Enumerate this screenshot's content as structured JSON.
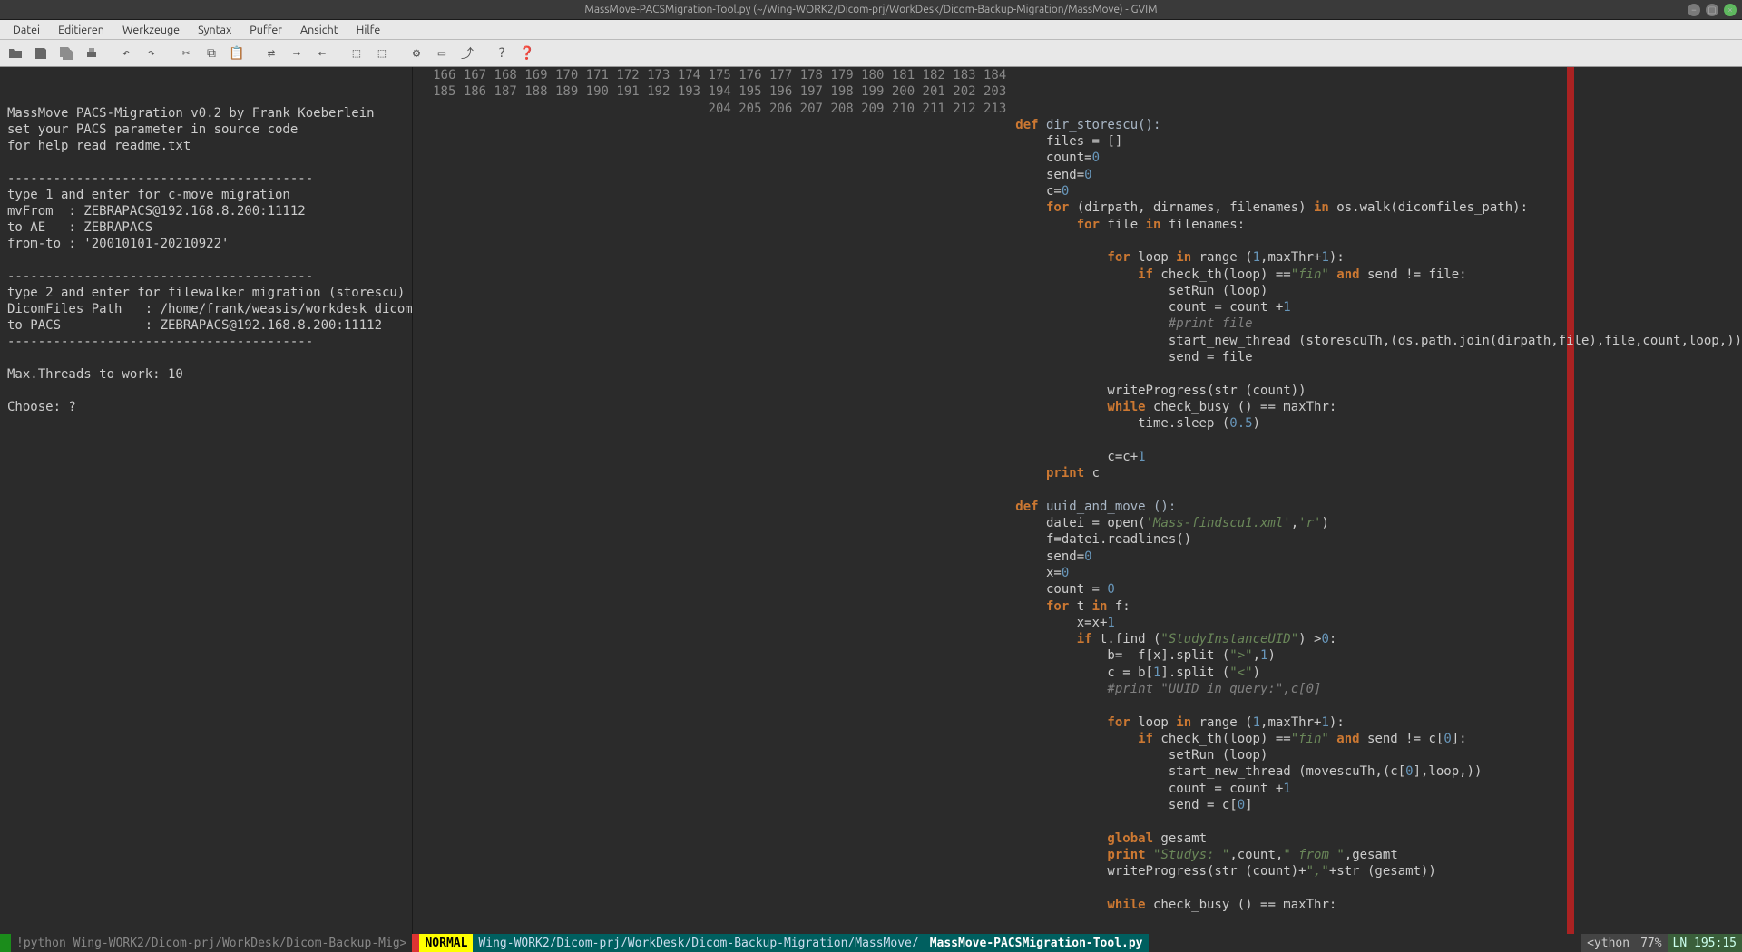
{
  "window": {
    "title": "MassMove-PACSMigration-Tool.py (~/Wing-WORK2/Dicom-prj/WorkDesk/Dicom-Backup-Migration/MassMove) - GVIM"
  },
  "menu": {
    "items": [
      "Datei",
      "Editieren",
      "Werkzeuge",
      "Syntax",
      "Puffer",
      "Ansicht",
      "Hilfe"
    ]
  },
  "left_pane": {
    "lines": [
      "",
      "",
      "MassMove PACS-Migration v0.2 by Frank Koeberlein",
      "set your PACS parameter in source code",
      "for help read readme.txt",
      "",
      "----------------------------------------",
      "type 1 and enter for c-move migration",
      "mvFrom  : ZEBRAPACS@192.168.8.200:11112",
      "to AE   : ZEBRAPACS",
      "from-to : '20010101-20210922'",
      "",
      "----------------------------------------",
      "type 2 and enter for filewalker migration (storescu)",
      "DicomFiles Path   : /home/frank/weasis/workdesk_dicom/",
      "to PACS           : ZEBRAPACS@192.168.8.200:11112",
      "----------------------------------------",
      "",
      "Max.Threads to work: 10",
      "",
      "Choose: ?"
    ]
  },
  "code": {
    "first_line": 166,
    "lines": [
      {
        "n": 166,
        "tokens": [
          {
            "t": "def ",
            "c": "kw"
          },
          {
            "t": "dir_storescu():",
            "c": "def"
          }
        ]
      },
      {
        "n": 167,
        "tokens": [
          {
            "t": "    files = []",
            "c": ""
          }
        ]
      },
      {
        "n": 168,
        "tokens": [
          {
            "t": "    count=",
            "c": ""
          },
          {
            "t": "0",
            "c": "num"
          }
        ]
      },
      {
        "n": 169,
        "tokens": [
          {
            "t": "    send=",
            "c": ""
          },
          {
            "t": "0",
            "c": "num"
          }
        ]
      },
      {
        "n": 170,
        "tokens": [
          {
            "t": "    c=",
            "c": ""
          },
          {
            "t": "0",
            "c": "num"
          }
        ]
      },
      {
        "n": 171,
        "tokens": [
          {
            "t": "    ",
            "c": ""
          },
          {
            "t": "for",
            "c": "kw"
          },
          {
            "t": " (dirpath, dirnames, filenames) ",
            "c": ""
          },
          {
            "t": "in",
            "c": "kw"
          },
          {
            "t": " os.walk(dicomfiles_path):",
            "c": ""
          }
        ]
      },
      {
        "n": 172,
        "tokens": [
          {
            "t": "        ",
            "c": ""
          },
          {
            "t": "for",
            "c": "kw"
          },
          {
            "t": " file ",
            "c": ""
          },
          {
            "t": "in",
            "c": "kw"
          },
          {
            "t": " filenames:",
            "c": ""
          }
        ]
      },
      {
        "n": 173,
        "tokens": [
          {
            "t": "",
            "c": ""
          }
        ]
      },
      {
        "n": 174,
        "tokens": [
          {
            "t": "            ",
            "c": ""
          },
          {
            "t": "for",
            "c": "kw"
          },
          {
            "t": " loop ",
            "c": ""
          },
          {
            "t": "in",
            "c": "kw"
          },
          {
            "t": " range (",
            "c": ""
          },
          {
            "t": "1",
            "c": "num"
          },
          {
            "t": ",maxThr+",
            "c": ""
          },
          {
            "t": "1",
            "c": "num"
          },
          {
            "t": "):",
            "c": ""
          }
        ]
      },
      {
        "n": 175,
        "tokens": [
          {
            "t": "                ",
            "c": ""
          },
          {
            "t": "if",
            "c": "kw"
          },
          {
            "t": " check_th(loop) ==",
            "c": ""
          },
          {
            "t": "\"fin\"",
            "c": "str"
          },
          {
            "t": " ",
            "c": ""
          },
          {
            "t": "and",
            "c": "kw"
          },
          {
            "t": " send != file:",
            "c": ""
          }
        ]
      },
      {
        "n": 176,
        "tokens": [
          {
            "t": "                    setRun (loop)",
            "c": ""
          }
        ]
      },
      {
        "n": 177,
        "tokens": [
          {
            "t": "                    count = count +",
            "c": ""
          },
          {
            "t": "1",
            "c": "num"
          }
        ]
      },
      {
        "n": 178,
        "tokens": [
          {
            "t": "                    ",
            "c": ""
          },
          {
            "t": "#print file",
            "c": "cmt"
          }
        ]
      },
      {
        "n": 179,
        "tokens": [
          {
            "t": "                    start_new_thread (storescuTh,(os.path.join(dirpath,file),file,count,loop,))",
            "c": ""
          }
        ]
      },
      {
        "n": 180,
        "tokens": [
          {
            "t": "                    send = file",
            "c": ""
          }
        ]
      },
      {
        "n": 181,
        "tokens": [
          {
            "t": "",
            "c": ""
          }
        ]
      },
      {
        "n": 182,
        "tokens": [
          {
            "t": "            writeProgress(str (count))",
            "c": ""
          }
        ]
      },
      {
        "n": 183,
        "tokens": [
          {
            "t": "            ",
            "c": ""
          },
          {
            "t": "while",
            "c": "kw"
          },
          {
            "t": " check_busy () == maxThr:",
            "c": ""
          }
        ]
      },
      {
        "n": 184,
        "tokens": [
          {
            "t": "                time.sleep (",
            "c": ""
          },
          {
            "t": "0.5",
            "c": "num"
          },
          {
            "t": ")",
            "c": ""
          }
        ]
      },
      {
        "n": 185,
        "tokens": [
          {
            "t": "",
            "c": ""
          }
        ]
      },
      {
        "n": 186,
        "tokens": [
          {
            "t": "            c=c+",
            "c": ""
          },
          {
            "t": "1",
            "c": "num"
          }
        ]
      },
      {
        "n": 187,
        "tokens": [
          {
            "t": "    ",
            "c": ""
          },
          {
            "t": "print",
            "c": "kw"
          },
          {
            "t": " c",
            "c": ""
          }
        ]
      },
      {
        "n": 188,
        "tokens": [
          {
            "t": "",
            "c": ""
          }
        ]
      },
      {
        "n": 189,
        "tokens": [
          {
            "t": "def ",
            "c": "kw"
          },
          {
            "t": "uuid_and_move ():",
            "c": "def"
          }
        ]
      },
      {
        "n": 190,
        "tokens": [
          {
            "t": "    datei = open(",
            "c": ""
          },
          {
            "t": "'Mass-findscu1.xml'",
            "c": "str"
          },
          {
            "t": ",",
            "c": ""
          },
          {
            "t": "'r'",
            "c": "str"
          },
          {
            "t": ")",
            "c": ""
          }
        ]
      },
      {
        "n": 191,
        "tokens": [
          {
            "t": "    f=datei.readlines()",
            "c": ""
          }
        ]
      },
      {
        "n": 192,
        "tokens": [
          {
            "t": "    send=",
            "c": ""
          },
          {
            "t": "0",
            "c": "num"
          }
        ]
      },
      {
        "n": 193,
        "tokens": [
          {
            "t": "    x=",
            "c": ""
          },
          {
            "t": "0",
            "c": "num"
          }
        ]
      },
      {
        "n": 194,
        "tokens": [
          {
            "t": "    count = ",
            "c": ""
          },
          {
            "t": "0",
            "c": "num"
          }
        ]
      },
      {
        "n": 195,
        "tokens": [
          {
            "t": "    ",
            "c": ""
          },
          {
            "t": "for",
            "c": "kw"
          },
          {
            "t": " t ",
            "c": ""
          },
          {
            "t": "in",
            "c": "kw"
          },
          {
            "t": " f:",
            "c": ""
          }
        ]
      },
      {
        "n": 196,
        "tokens": [
          {
            "t": "        x=x+",
            "c": ""
          },
          {
            "t": "1",
            "c": "num"
          }
        ]
      },
      {
        "n": 197,
        "tokens": [
          {
            "t": "        ",
            "c": ""
          },
          {
            "t": "if",
            "c": "kw"
          },
          {
            "t": " t.find (",
            "c": ""
          },
          {
            "t": "\"StudyInstanceUID\"",
            "c": "str"
          },
          {
            "t": ") >",
            "c": ""
          },
          {
            "t": "0",
            "c": "num"
          },
          {
            "t": ":",
            "c": ""
          }
        ]
      },
      {
        "n": 198,
        "tokens": [
          {
            "t": "            b=  f[x].split (",
            "c": ""
          },
          {
            "t": "\">\"",
            "c": "str"
          },
          {
            "t": ",",
            "c": ""
          },
          {
            "t": "1",
            "c": "num"
          },
          {
            "t": ")",
            "c": ""
          }
        ]
      },
      {
        "n": 199,
        "tokens": [
          {
            "t": "            c = b[",
            "c": ""
          },
          {
            "t": "1",
            "c": "num"
          },
          {
            "t": "].split (",
            "c": ""
          },
          {
            "t": "\"<\"",
            "c": "str"
          },
          {
            "t": ")",
            "c": ""
          }
        ]
      },
      {
        "n": 200,
        "tokens": [
          {
            "t": "            ",
            "c": ""
          },
          {
            "t": "#print \"UUID in query:\",c[0]",
            "c": "cmt"
          }
        ]
      },
      {
        "n": 201,
        "tokens": [
          {
            "t": "",
            "c": ""
          }
        ]
      },
      {
        "n": 202,
        "tokens": [
          {
            "t": "            ",
            "c": ""
          },
          {
            "t": "for",
            "c": "kw"
          },
          {
            "t": " loop ",
            "c": ""
          },
          {
            "t": "in",
            "c": "kw"
          },
          {
            "t": " range (",
            "c": ""
          },
          {
            "t": "1",
            "c": "num"
          },
          {
            "t": ",maxThr+",
            "c": ""
          },
          {
            "t": "1",
            "c": "num"
          },
          {
            "t": "):",
            "c": ""
          }
        ]
      },
      {
        "n": 203,
        "tokens": [
          {
            "t": "                ",
            "c": ""
          },
          {
            "t": "if",
            "c": "kw"
          },
          {
            "t": " check_th(loop) ==",
            "c": ""
          },
          {
            "t": "\"fin\"",
            "c": "str"
          },
          {
            "t": " ",
            "c": ""
          },
          {
            "t": "and",
            "c": "kw"
          },
          {
            "t": " send != c[",
            "c": ""
          },
          {
            "t": "0",
            "c": "num"
          },
          {
            "t": "]:",
            "c": ""
          }
        ]
      },
      {
        "n": 204,
        "tokens": [
          {
            "t": "                    setRun (loop)",
            "c": ""
          }
        ]
      },
      {
        "n": 205,
        "tokens": [
          {
            "t": "                    start_new_thread (movescuTh,(c[",
            "c": ""
          },
          {
            "t": "0",
            "c": "num"
          },
          {
            "t": "],loop,))",
            "c": ""
          }
        ]
      },
      {
        "n": 206,
        "tokens": [
          {
            "t": "                    count = count +",
            "c": ""
          },
          {
            "t": "1",
            "c": "num"
          }
        ]
      },
      {
        "n": 207,
        "tokens": [
          {
            "t": "                    send = c[",
            "c": ""
          },
          {
            "t": "0",
            "c": "num"
          },
          {
            "t": "]",
            "c": ""
          }
        ]
      },
      {
        "n": 208,
        "tokens": [
          {
            "t": "",
            "c": ""
          }
        ]
      },
      {
        "n": 209,
        "tokens": [
          {
            "t": "            ",
            "c": ""
          },
          {
            "t": "global",
            "c": "kw"
          },
          {
            "t": " gesamt",
            "c": ""
          }
        ]
      },
      {
        "n": 210,
        "tokens": [
          {
            "t": "            ",
            "c": ""
          },
          {
            "t": "print",
            "c": "kw"
          },
          {
            "t": " ",
            "c": ""
          },
          {
            "t": "\"Studys: \"",
            "c": "str"
          },
          {
            "t": ",count,",
            "c": ""
          },
          {
            "t": "\" from \"",
            "c": "str"
          },
          {
            "t": ",gesamt",
            "c": ""
          }
        ]
      },
      {
        "n": 211,
        "tokens": [
          {
            "t": "            writeProgress(str (count)+",
            "c": ""
          },
          {
            "t": "\",\"",
            "c": "str"
          },
          {
            "t": "+str (gesamt))",
            "c": ""
          }
        ]
      },
      {
        "n": 212,
        "tokens": [
          {
            "t": "",
            "c": ""
          }
        ]
      },
      {
        "n": 213,
        "tokens": [
          {
            "t": "            ",
            "c": ""
          },
          {
            "t": "while",
            "c": "kw"
          },
          {
            "t": " check_busy () == maxThr:",
            "c": ""
          }
        ]
      }
    ]
  },
  "status": {
    "cmd": " !python Wing-WORK2/Dicom-prj/WorkDesk/Dicom-Backup-Mig>",
    "mode": " NORMAL ",
    "path": " Wing-WORK2/Dicom-prj/WorkDesk/Dicom-Backup-Migration/MassMove/",
    "file": "MassMove-PACSMigration-Tool.py ",
    "ft": " <ython ",
    "pct": " 77% ",
    "ln": " LN  195:15 "
  }
}
